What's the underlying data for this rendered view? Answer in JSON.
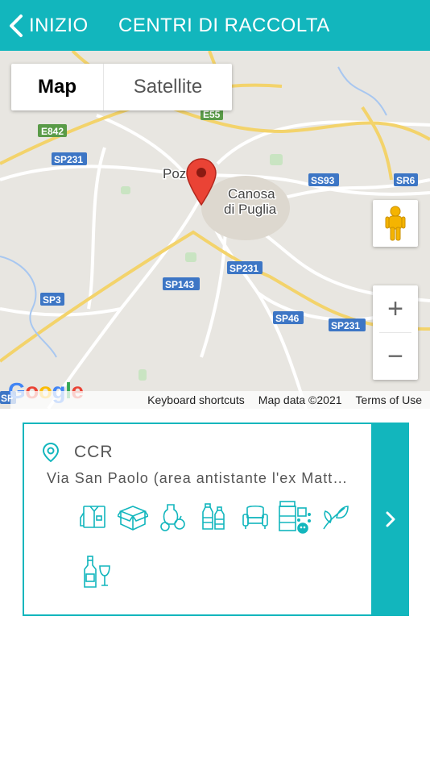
{
  "header": {
    "back_label": "INIZIO",
    "title": "CENTRI DI RACCOLTA",
    "color": "#12b6bd"
  },
  "map": {
    "type_control": {
      "map_label": "Map",
      "satellite_label": "Satellite",
      "selected": "Map"
    },
    "road_labels": [
      "E842",
      "E55",
      "SP231",
      "SS93",
      "SR6",
      "SP143",
      "SP231",
      "SP3",
      "SP46",
      "SP231",
      "SP"
    ],
    "place_labels": {
      "poz": "Poz",
      "canosa_1": "Canosa",
      "canosa_2": "di Puglia"
    },
    "zoom_in": "+",
    "zoom_out": "−",
    "logo": "Google",
    "attribution": {
      "shortcuts": "Keyboard shortcuts",
      "data": "Map data ©2021",
      "terms": "Terms of Use"
    }
  },
  "card": {
    "title": "CCR",
    "address": "Via San Paolo (area antistante l'ex Matt…",
    "icons": [
      "clothes-icon",
      "cardboard-box-icon",
      "organic-waste-icon",
      "plastic-bottles-icon",
      "furniture-icon",
      "hazardous-waste-icon",
      "green-waste-icon",
      "glass-bottle-icon"
    ],
    "accent": "#12b6bd"
  }
}
